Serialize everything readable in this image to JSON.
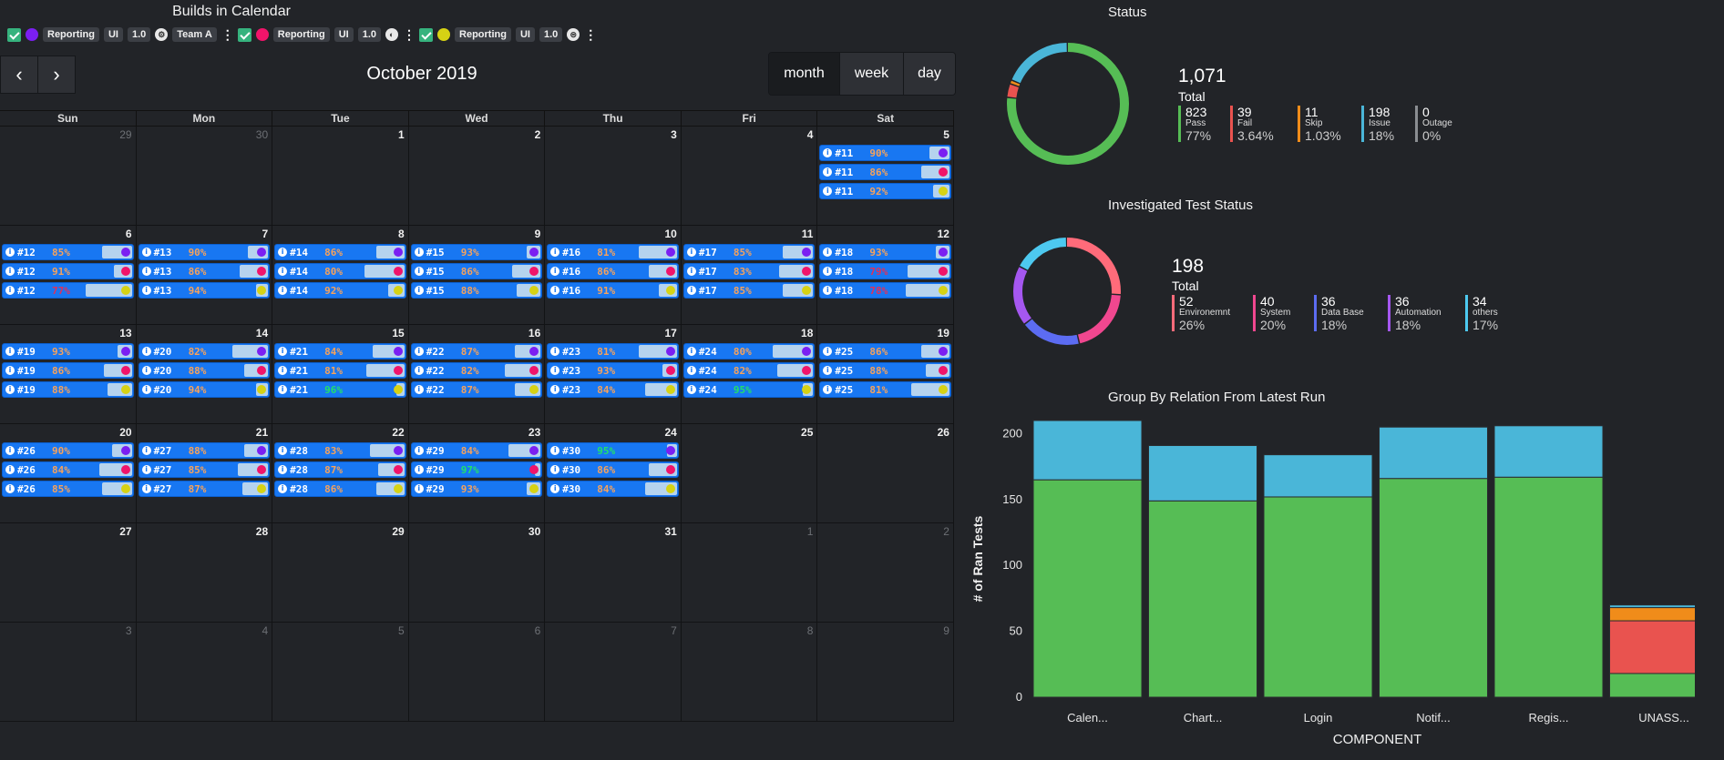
{
  "calendar": {
    "title": "Builds in Calendar",
    "filters": [
      {
        "dot_color": "#7b1ff2",
        "chips": [
          "Reporting",
          "UI",
          "1.0"
        ],
        "icon": "⚙",
        "team": "Team A"
      },
      {
        "dot_color": "#f0146a",
        "chips": [
          "Reporting",
          "UI",
          "1.0"
        ],
        "icon": "◐",
        "team": ""
      },
      {
        "dot_color": "#d6d214",
        "chips": [
          "Reporting",
          "UI",
          "1.0"
        ],
        "icon": "⊜",
        "team": ""
      }
    ],
    "prev_label": "‹",
    "next_label": "›",
    "month_label": "October 2019",
    "views": [
      "month",
      "week",
      "day"
    ],
    "active_view": "month",
    "weekdays": [
      "Sun",
      "Mon",
      "Tue",
      "Wed",
      "Thu",
      "Fri",
      "Sat"
    ],
    "weeks": [
      [
        {
          "d": "29",
          "o": true
        },
        {
          "d": "30",
          "o": true
        },
        {
          "d": "1"
        },
        {
          "d": "2"
        },
        {
          "d": "3"
        },
        {
          "d": "4"
        },
        {
          "d": "5",
          "ev": [
            [
              "#11",
              "90%",
              1
            ],
            [
              "#11",
              "86%",
              2
            ],
            [
              "#11",
              "92%",
              3
            ]
          ]
        }
      ],
      [
        {
          "d": "6",
          "ev": [
            [
              "#12",
              "85%",
              1
            ],
            [
              "#12",
              "91%",
              2
            ],
            [
              "#12",
              "77%",
              3
            ]
          ]
        },
        {
          "d": "7",
          "ev": [
            [
              "#13",
              "90%",
              1
            ],
            [
              "#13",
              "86%",
              2
            ],
            [
              "#13",
              "94%",
              3
            ]
          ]
        },
        {
          "d": "8",
          "ev": [
            [
              "#14",
              "86%",
              1
            ],
            [
              "#14",
              "80%",
              2
            ],
            [
              "#14",
              "92%",
              3
            ]
          ]
        },
        {
          "d": "9",
          "ev": [
            [
              "#15",
              "93%",
              1
            ],
            [
              "#15",
              "86%",
              2
            ],
            [
              "#15",
              "88%",
              3
            ]
          ]
        },
        {
          "d": "10",
          "ev": [
            [
              "#16",
              "81%",
              1
            ],
            [
              "#16",
              "86%",
              2
            ],
            [
              "#16",
              "91%",
              3
            ]
          ]
        },
        {
          "d": "11",
          "ev": [
            [
              "#17",
              "85%",
              1
            ],
            [
              "#17",
              "83%",
              2
            ],
            [
              "#17",
              "85%",
              3
            ]
          ]
        },
        {
          "d": "12",
          "ev": [
            [
              "#18",
              "93%",
              1
            ],
            [
              "#18",
              "79%",
              2
            ],
            [
              "#18",
              "78%",
              3
            ]
          ]
        }
      ],
      [
        {
          "d": "13",
          "ev": [
            [
              "#19",
              "93%",
              1
            ],
            [
              "#19",
              "86%",
              2
            ],
            [
              "#19",
              "88%",
              3
            ]
          ]
        },
        {
          "d": "14",
          "ev": [
            [
              "#20",
              "82%",
              1
            ],
            [
              "#20",
              "88%",
              2
            ],
            [
              "#20",
              "94%",
              3
            ]
          ]
        },
        {
          "d": "15",
          "ev": [
            [
              "#21",
              "84%",
              1
            ],
            [
              "#21",
              "81%",
              2
            ],
            [
              "#21",
              "96%",
              3
            ]
          ]
        },
        {
          "d": "16",
          "ev": [
            [
              "#22",
              "87%",
              1
            ],
            [
              "#22",
              "82%",
              2
            ],
            [
              "#22",
              "87%",
              3
            ]
          ]
        },
        {
          "d": "17",
          "ev": [
            [
              "#23",
              "81%",
              1
            ],
            [
              "#23",
              "93%",
              2
            ],
            [
              "#23",
              "84%",
              3
            ]
          ]
        },
        {
          "d": "18",
          "ev": [
            [
              "#24",
              "80%",
              1
            ],
            [
              "#24",
              "82%",
              2
            ],
            [
              "#24",
              "95%",
              3
            ]
          ]
        },
        {
          "d": "19",
          "ev": [
            [
              "#25",
              "86%",
              1
            ],
            [
              "#25",
              "88%",
              2
            ],
            [
              "#25",
              "81%",
              3
            ]
          ]
        }
      ],
      [
        {
          "d": "20",
          "ev": [
            [
              "#26",
              "90%",
              1
            ],
            [
              "#26",
              "84%",
              2
            ],
            [
              "#26",
              "85%",
              3
            ]
          ]
        },
        {
          "d": "21",
          "ev": [
            [
              "#27",
              "88%",
              1
            ],
            [
              "#27",
              "85%",
              2
            ],
            [
              "#27",
              "87%",
              3
            ]
          ]
        },
        {
          "d": "22",
          "ev": [
            [
              "#28",
              "83%",
              1
            ],
            [
              "#28",
              "87%",
              2
            ],
            [
              "#28",
              "86%",
              3
            ]
          ]
        },
        {
          "d": "23",
          "ev": [
            [
              "#29",
              "84%",
              1
            ],
            [
              "#29",
              "97%",
              2
            ],
            [
              "#29",
              "93%",
              3
            ]
          ]
        },
        {
          "d": "24",
          "ev": [
            [
              "#30",
              "95%",
              1
            ],
            [
              "#30",
              "86%",
              2
            ],
            [
              "#30",
              "84%",
              3
            ]
          ]
        },
        {
          "d": "25"
        },
        {
          "d": "26"
        }
      ],
      [
        {
          "d": "27"
        },
        {
          "d": "28"
        },
        {
          "d": "29"
        },
        {
          "d": "30"
        },
        {
          "d": "31"
        },
        {
          "d": "1",
          "o": true
        },
        {
          "d": "2",
          "o": true
        }
      ],
      [
        {
          "d": "3",
          "o": true
        },
        {
          "d": "4",
          "o": true
        },
        {
          "d": "5",
          "o": true
        },
        {
          "d": "6",
          "o": true
        },
        {
          "d": "7",
          "o": true
        },
        {
          "d": "8",
          "o": true
        },
        {
          "d": "9",
          "o": true
        }
      ]
    ],
    "colors": {
      "pct_orange": "#f5a25d",
      "pct_red": "#e0305a",
      "pct_green": "#22e06a",
      "event_blue": "#1877f2"
    }
  },
  "status": {
    "title": "Status",
    "total_value": "1,071",
    "total_label": "Total",
    "items": [
      {
        "value": "823",
        "label": "Pass",
        "pct": "77%",
        "color": "#56bd55",
        "n": 823
      },
      {
        "value": "39",
        "label": "Fail",
        "pct": "3.64%",
        "color": "#e9534f",
        "n": 39
      },
      {
        "value": "11",
        "label": "Skip",
        "pct": "1.03%",
        "color": "#f08c1a",
        "n": 11
      },
      {
        "value": "198",
        "label": "Issue",
        "pct": "18%",
        "color": "#4ab6d8",
        "n": 198
      },
      {
        "value": "0",
        "label": "Outage",
        "pct": "0%",
        "color": "#8a8d91",
        "n": 0
      }
    ]
  },
  "investigated": {
    "title": "Investigated Test Status",
    "total_value": "198",
    "total_label": "Total",
    "items": [
      {
        "value": "52",
        "label": "Environemnt",
        "pct": "26%",
        "color": "#ff6b7a",
        "n": 52
      },
      {
        "value": "40",
        "label": "System",
        "pct": "20%",
        "color": "#f0478f",
        "n": 40
      },
      {
        "value": "36",
        "label": "Data Base",
        "pct": "18%",
        "color": "#5c6cf2",
        "n": 36
      },
      {
        "value": "36",
        "label": "Automation",
        "pct": "18%",
        "color": "#a557f0",
        "n": 36
      },
      {
        "value": "34",
        "label": "others",
        "pct": "17%",
        "color": "#4dc9f0",
        "n": 34
      }
    ]
  },
  "relation": {
    "title": "Group By Relation From Latest Run"
  },
  "chart_data": {
    "type": "bar",
    "stacked": true,
    "title": "Group By Relation From Latest Run",
    "xlabel": "COMPONENT",
    "ylabel": "# of Ran Tests",
    "categories": [
      "Calen...",
      "Chart...",
      "Login",
      "Notif...",
      "Regis...",
      "UNASS..."
    ],
    "ylim": [
      0,
      210
    ],
    "yticks": [
      0,
      50,
      100,
      150,
      200
    ],
    "series": [
      {
        "color": "#56bd55",
        "values": [
          165,
          149,
          152,
          166,
          167,
          18
        ]
      },
      {
        "color": "#e9534f",
        "values": [
          0,
          0,
          0,
          0,
          0,
          40
        ]
      },
      {
        "color": "#f08c1a",
        "values": [
          0,
          0,
          0,
          0,
          0,
          10
        ]
      },
      {
        "color": "#4ab6d8",
        "values": [
          45,
          42,
          32,
          39,
          39,
          2
        ]
      }
    ]
  }
}
